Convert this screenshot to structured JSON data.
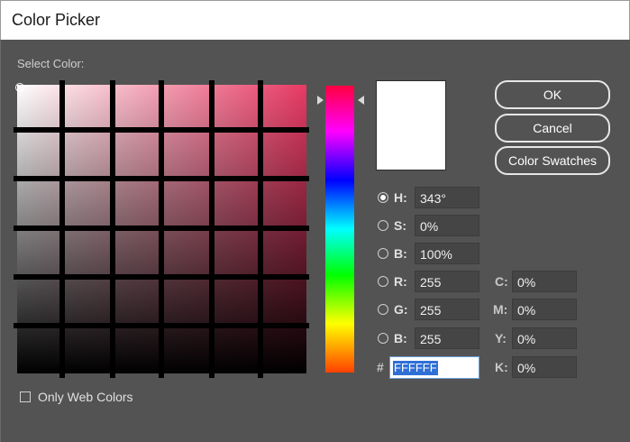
{
  "window": {
    "title": "Color Picker"
  },
  "picker": {
    "select_label": "Select Color:"
  },
  "buttons": {
    "ok": "OK",
    "cancel": "Cancel",
    "swatches": "Color Swatches"
  },
  "hsb": [
    {
      "label": "H:",
      "value": "343°",
      "selected": true
    },
    {
      "label": "S:",
      "value": "0%",
      "selected": false
    },
    {
      "label": "B:",
      "value": "100%",
      "selected": false
    }
  ],
  "rgb": [
    {
      "label": "R:",
      "value": "255",
      "selected": false
    },
    {
      "label": "G:",
      "value": "255",
      "selected": false
    },
    {
      "label": "B:",
      "value": "255",
      "selected": false
    }
  ],
  "cmyk": [
    {
      "label": "C:",
      "value": "0%"
    },
    {
      "label": "M:",
      "value": "0%"
    },
    {
      "label": "Y:",
      "value": "0%"
    },
    {
      "label": "K:",
      "value": "0%"
    }
  ],
  "hex": {
    "label": "#",
    "value": "FFFFFF"
  },
  "web_only": {
    "label": "Only Web Colors",
    "checked": false
  },
  "colors": {
    "current": "#ffffff",
    "hue": "#e83a64",
    "background": "#535353"
  }
}
